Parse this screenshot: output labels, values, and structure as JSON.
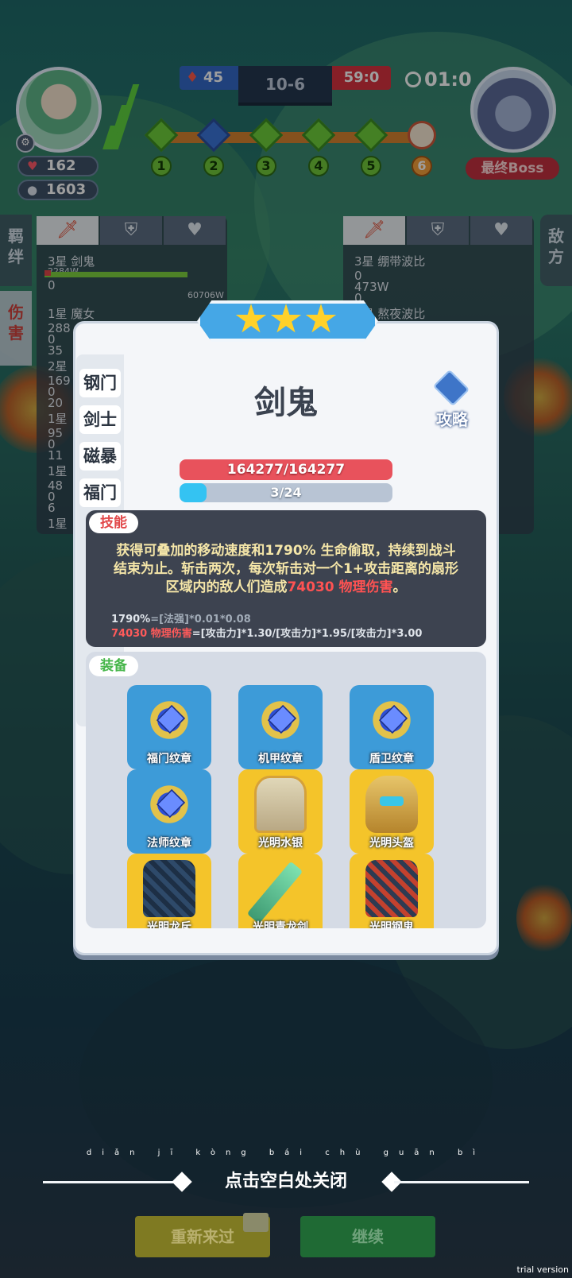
{
  "hud": {
    "hp": "162",
    "coins": "1603",
    "fire_score": "45",
    "stage": "10-6",
    "enemy_score": "59:0",
    "timer": "01:0",
    "stages": [
      "1",
      "2",
      "3",
      "4",
      "5",
      "6"
    ],
    "boss_label": "最终Boss"
  },
  "left_tabs": {
    "bond": "羁\n绊",
    "damage": "伤\n害"
  },
  "right_tabs": {
    "enemy": "敌\n方"
  },
  "left_panel": {
    "rows": [
      "3星 剑鬼",
      "2284W",
      "0",
      "60706W",
      "1星 魔女",
      "288",
      "0",
      "35",
      "2星",
      "169",
      "0",
      "20",
      "1星",
      "95",
      "0",
      "11",
      "1星",
      "48",
      "0",
      "6",
      "1星"
    ]
  },
  "right_panel": {
    "rows": [
      "3星 绷带波比",
      "0",
      "473W",
      "0",
      "3星 熬夜波比"
    ]
  },
  "modal": {
    "stars": 3,
    "categories": [
      "钢门",
      "剑士",
      "磁暴",
      "福门"
    ],
    "hero_name": "剑鬼",
    "guide_label": "攻略",
    "hp_text": "164277/164277",
    "mp_text": "3/24",
    "mp_fraction": 0.125,
    "skill_tag": "技能",
    "skill_desc_1": "获得可叠加的移动速度和1790% 生命偷取，持续到战斗结束为止。斩击两次，每次斩击对一个1+攻击距离的扇形区域内的敌人们造成",
    "skill_dmg": "74030 物理伤害",
    "skill_desc_end": "。",
    "formula1_value": "1790%",
    "formula1_expr": "=[法强]*0.01*0.08",
    "formula2_value": "74030 物理伤害",
    "formula2_expr": "=[攻击力]*1.30/[攻击力]*1.95/[攻击力]*3.00",
    "equip_tag": "装备",
    "equipment": [
      {
        "name": "福门纹章",
        "kind": "emblem",
        "bg": "blue"
      },
      {
        "name": "机甲纹章",
        "kind": "emblem",
        "bg": "blue"
      },
      {
        "name": "盾卫纹章",
        "kind": "emblem",
        "bg": "blue"
      },
      {
        "name": "法师纹章",
        "kind": "emblem",
        "bg": "blue"
      },
      {
        "name": "光明水银",
        "kind": "cloak",
        "bg": "gold"
      },
      {
        "name": "光明头盔",
        "kind": "helm",
        "bg": "gold"
      },
      {
        "name": "光明龙斥",
        "kind": "armor-blue",
        "bg": "gold"
      },
      {
        "name": "光明青龙剑",
        "kind": "sword",
        "bg": "gold"
      },
      {
        "name": "光明钢鬼",
        "kind": "armor-red",
        "bg": "gold"
      }
    ]
  },
  "footer": {
    "close_pinyin": "diǎn jī kòng bái chù guān bì",
    "close_hint": "点击空白处关闭",
    "retry": "重新来过",
    "continue": "继续"
  },
  "watermark": "trial version",
  "colors": {
    "accent_red": "#e2484a",
    "accent_blue": "#34c3f2",
    "equip_blue": "#3d9bd8",
    "equip_gold": "#f4c42a",
    "progress_green": "#6fcf3a"
  }
}
